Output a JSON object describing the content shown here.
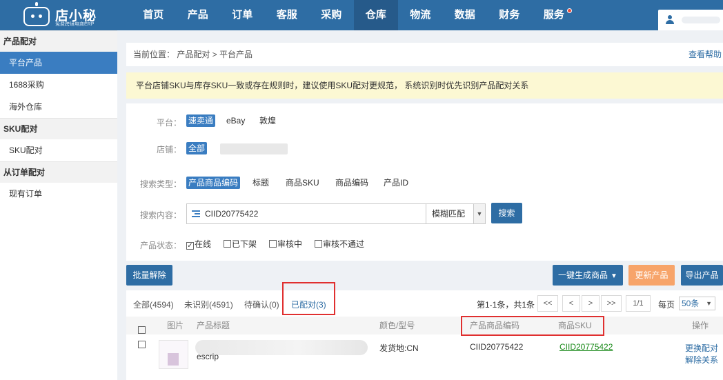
{
  "brand": {
    "name": "店小秘",
    "tagline": "免费跨境电商ERP"
  },
  "nav": [
    {
      "label": "首页",
      "active": false
    },
    {
      "label": "产品",
      "active": false
    },
    {
      "label": "订单",
      "active": false
    },
    {
      "label": "客服",
      "active": false
    },
    {
      "label": "采购",
      "active": false
    },
    {
      "label": "仓库",
      "active": true
    },
    {
      "label": "物流",
      "active": false
    },
    {
      "label": "数据",
      "active": false
    },
    {
      "label": "财务",
      "active": false
    },
    {
      "label": "服务",
      "active": false
    }
  ],
  "sidebar": {
    "group1": "产品配对",
    "item_platform": "平台产品",
    "item_1688": "1688采购",
    "item_overseas": "海外仓库",
    "group2": "SKU配对",
    "item_sku": "SKU配对",
    "group3": "从订单配对",
    "item_orders": "现有订单"
  },
  "breadcrumb": {
    "text": "当前位置：  产品配对 > 平台产品",
    "help": "查看帮助"
  },
  "notice": "平台店铺SKU与库存SKU一致或存在规则时，建议使用SKU配对更规范， 系统识别时优先识别产品配对关系",
  "filters": {
    "platform_label": "平台：",
    "platforms": [
      "速卖通",
      "eBay",
      "敦煌"
    ],
    "store_label": "店铺：",
    "store_all": "全部",
    "search_type_label": "搜索类型：",
    "search_types": [
      "产品商品编码",
      "标题",
      "商品SKU",
      "商品编码",
      "产品ID"
    ],
    "search_content_label": "搜索内容：",
    "search_value": "CIID20775422",
    "match_mode": "模糊匹配",
    "search_button": "搜索",
    "status_label": "产品状态：",
    "statuses": [
      "在线",
      "已下架",
      "审核中",
      "审核不通过"
    ]
  },
  "actions": {
    "batch_unbind": "批量解除",
    "generate": "一键生成商品",
    "update": "更新产品",
    "export": "导出产品"
  },
  "tabs": {
    "all": "全部(4594)",
    "unrecognized": "未识别(4591)",
    "pending": "待确认(0)",
    "matched": "已配对(3)"
  },
  "pager": {
    "info": "第1-1条，共1条",
    "first": "<<",
    "prev": "<",
    "next": ">",
    "last": ">>",
    "page": "1/1",
    "per_page_label": "每页",
    "per_page": "50条"
  },
  "table": {
    "headers": {
      "image": "图片",
      "title": "产品标题",
      "variant": "颜色/型号",
      "code": "产品商品编码",
      "sku": "商品SKU",
      "ops": "操作"
    },
    "row": {
      "title_fragment": "escrip",
      "variant": "发货地:CN",
      "code": "CIID20775422",
      "sku": "CIID20775422",
      "op_change": "更换配对",
      "op_unbind": "解除关系"
    }
  }
}
